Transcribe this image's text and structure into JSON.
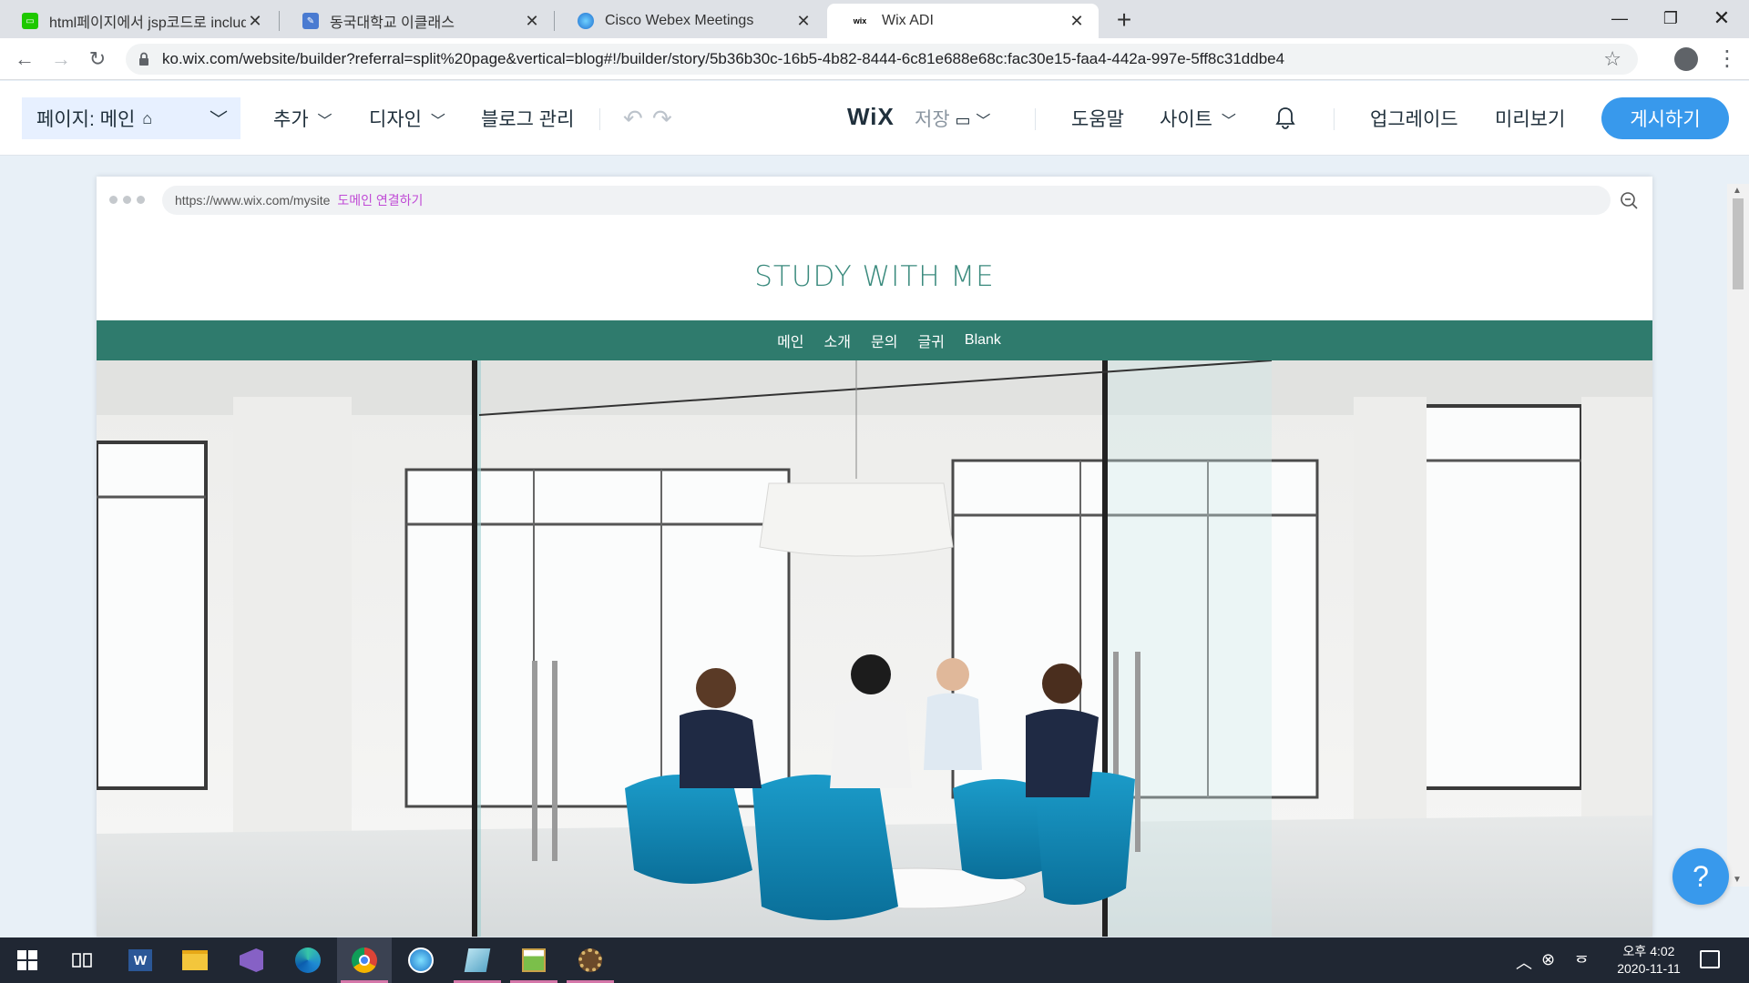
{
  "browser": {
    "tabs": [
      {
        "title": "html페이지에서 jsp코드로 includ",
        "close": "✕"
      },
      {
        "title": "동국대학교 이클래스",
        "close": "✕"
      },
      {
        "title": "Cisco Webex Meetings",
        "close": "✕"
      },
      {
        "title": "Wix ADI",
        "close": "✕",
        "active": true
      }
    ],
    "new_tab": "+",
    "url": "ko.wix.com/website/builder?referral=split%20page&vertical=blog#!/builder/story/5b36b30c-16b5-4b82-8444-6c81e688e68c:fac30e15-faa4-442a-997e-5ff8c31ddbe4"
  },
  "wix": {
    "page_selector": "페이지: 메인",
    "menus": {
      "add": "추가",
      "design": "디자인",
      "blog": "블로그 관리",
      "save": "저장 ",
      "help": "도움말",
      "site": "사이트",
      "upgrade": "업그레이드",
      "preview": "미리보기",
      "publish": "게시하기"
    },
    "logo": "WiX"
  },
  "site_preview": {
    "url": "https://www.wix.com/mysite",
    "connect_domain": "도메인 연결하기",
    "title": "STUDY WITH ME",
    "nav": [
      "메인",
      "소개",
      "문의",
      "글귀",
      "Blank"
    ]
  },
  "help_button": "?",
  "taskbar": {
    "time": "오후 4:02",
    "date": "2020-11-11"
  },
  "colors": {
    "accent": "#3899ec",
    "site_green": "#2f7b6d",
    "title_teal": "#3a8a7d"
  }
}
